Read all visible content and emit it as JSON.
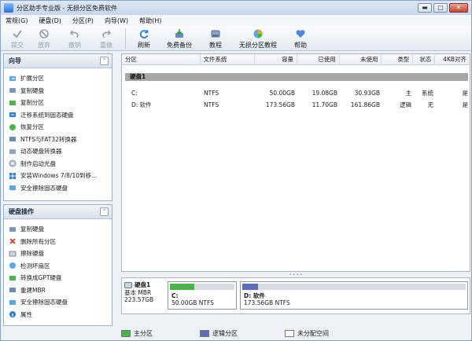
{
  "title": "分区助手专业版 - 无损分区免费软件",
  "window_buttons": {
    "minimize": "▬",
    "restore": "□",
    "close": "✕"
  },
  "menu": [
    "常规(G)",
    "硬盘(D)",
    "分区(P)",
    "向导(W)",
    "帮助(H)"
  ],
  "toolbar": {
    "submit": "提交",
    "discard": "放弃",
    "undo": "撤销",
    "redo": "重做",
    "refresh": "刷新",
    "free_backup": "免费备份",
    "tutorial": "教程",
    "lossless_tutorial": "无损分区教程",
    "help": "帮助"
  },
  "wizard_panel": {
    "title": "向导",
    "items": [
      "扩展分区",
      "复制硬盘",
      "复制分区",
      "迁移系统到固态硬盘",
      "恢复分区",
      "NTFS与FAT32转换器",
      "动态硬盘转换器",
      "制作启动光盘",
      "安装Windows 7/8/10到移...",
      "安全擦除固态硬盘"
    ]
  },
  "disk_ops_panel": {
    "title": "硬盘操作",
    "items": [
      "复制硬盘",
      "删除所有分区",
      "擦除硬盘",
      "检测坏扇区",
      "转换成GPT硬盘",
      "重建MBR",
      "安全擦除固态硬盘",
      "属性"
    ]
  },
  "table": {
    "headers": [
      "分区",
      "文件系统",
      "容量",
      "已使用",
      "未使用",
      "类型",
      "状态",
      "4KB对齐"
    ],
    "disk_label": "硬盘1",
    "rows": [
      [
        "C:",
        "NTFS",
        "50.00GB",
        "19.08GB",
        "30.93GB",
        "主",
        "系统",
        "是"
      ],
      [
        "D: 软件",
        "NTFS",
        "173.56GB",
        "11.70GB",
        "161.86GB",
        "逻辑",
        "无",
        "是"
      ]
    ]
  },
  "disk_map": {
    "disk_name": "硬盘1",
    "disk_type": "基本 MBR",
    "disk_size": "223.57GB",
    "partitions": [
      {
        "name": "C:",
        "detail": "50.00GB NTFS",
        "used_fraction": 0.38,
        "color": "#4cb24c"
      },
      {
        "name": "D: 软件",
        "detail": "173.56GB NTFS",
        "used_fraction": 0.07,
        "color": "#5f6bb5"
      }
    ]
  },
  "legend": {
    "primary": "主分区",
    "logical": "逻辑分区",
    "unallocated": "未分配空间"
  },
  "colors": {
    "primary": "#4cb24c",
    "logical": "#5f6bb5",
    "unallocated": "#ffffff",
    "disk_row": "#a7a7a7"
  }
}
